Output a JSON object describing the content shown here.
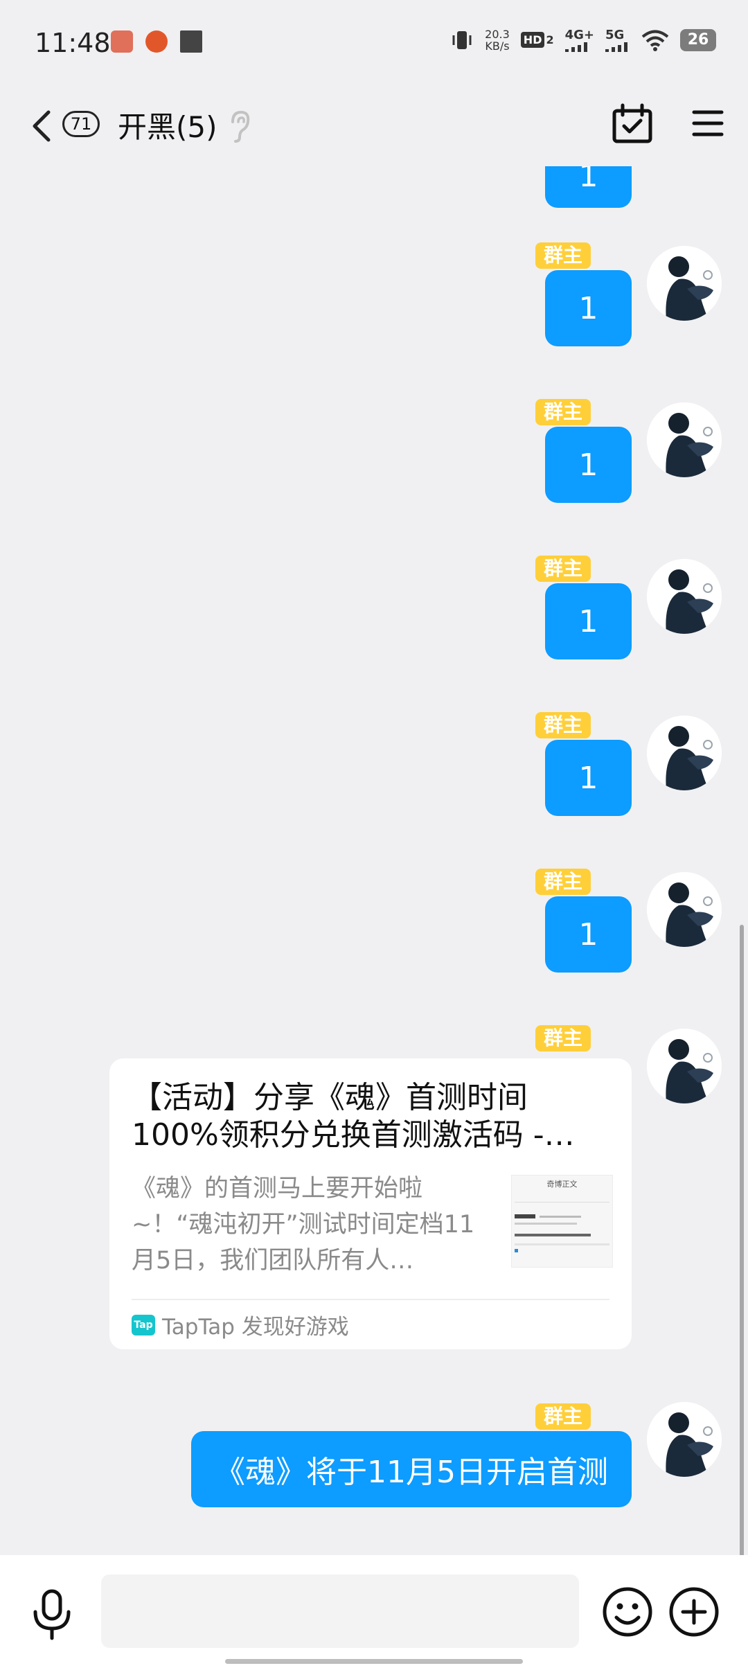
{
  "status_bar": {
    "time": "11:48",
    "net_speed_value": "20.3",
    "net_speed_unit": "KB/s",
    "hd_label": "HD",
    "sim_slot": "2",
    "signal_4g": "4G+",
    "signal_5g": "5G",
    "battery": "26"
  },
  "header": {
    "unread_count": "71",
    "title": "开黑(5)"
  },
  "messages": [
    {
      "role": "群主",
      "text": "1"
    },
    {
      "role": "群主",
      "text": "1"
    },
    {
      "role": "群主",
      "text": "1"
    },
    {
      "role": "群主",
      "text": "1"
    },
    {
      "role": "群主",
      "text": "1"
    },
    {
      "role": "群主",
      "card": {
        "title": "【活动】分享《魂》首测时间100%领积分兑换首测激活码 -…",
        "description": "《魂》的首测马上要开始啦~！“魂沌初开”测试时间定档11月5日，我们团队所有人…",
        "thumbnail_title": "奇博正文",
        "source": "TapTap 发现好游戏",
        "source_logo": "Tap"
      }
    },
    {
      "role": "群主",
      "text": "《魂》将于11月5日开启首测"
    }
  ],
  "partial_top_text": "1",
  "input": {
    "placeholder": ""
  },
  "colors": {
    "bubble": "#0d9cff",
    "badge": "#ffcf3a",
    "background": "#f0f0f2",
    "taptap": "#15c5ce"
  }
}
